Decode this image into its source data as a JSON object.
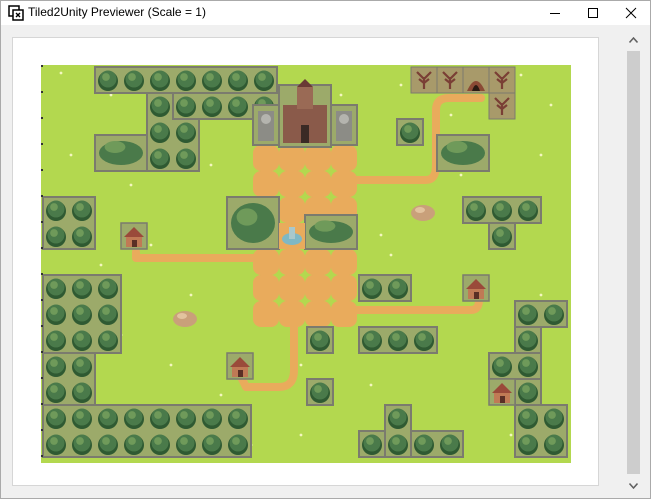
{
  "window": {
    "title": "Tiled2Unity Previewer (Scale = 1)",
    "app_icon": "tiled2unity-icon",
    "controls": [
      "minimize-icon",
      "maximize-icon",
      "close-icon"
    ]
  },
  "map": {
    "grass_color": "#b3d84f",
    "path_color": "#e9ab5c",
    "selection_outline": "#7b7b6e",
    "tree_color": "#4a7a4a",
    "castle_color": "#8a5a4a"
  },
  "scrollbar": {
    "up_icon": "scroll-up-arrow-icon",
    "down_icon": "scroll-down-arrow-icon"
  }
}
